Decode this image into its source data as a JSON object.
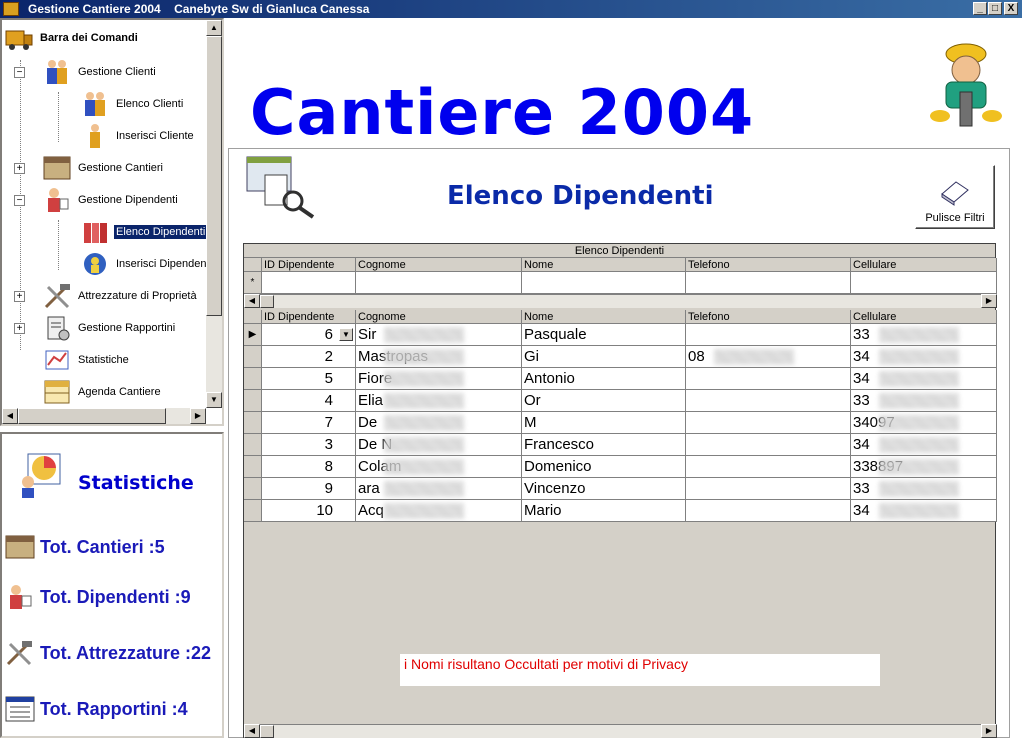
{
  "window": {
    "title": "Gestione Cantiere 2004    Canebyte Sw di Gianluca Canessa",
    "min_label": "_",
    "max_label": "□",
    "close_label": "X"
  },
  "tree": {
    "root": "Barra dei Comandi",
    "items": [
      {
        "label": "Gestione Clienti"
      },
      {
        "label": "Elenco Clienti"
      },
      {
        "label": "Inserisci Cliente"
      },
      {
        "label": "Gestione Cantieri"
      },
      {
        "label": "Gestione Dipendenti"
      },
      {
        "label": "Elenco Dipendenti"
      },
      {
        "label": "Inserisci Dipendent"
      },
      {
        "label": "Attrezzature di Proprietà"
      },
      {
        "label": "Gestione Rapportini"
      },
      {
        "label": "Statistiche"
      },
      {
        "label": "Agenda Cantiere"
      }
    ],
    "expand_plus": "+",
    "expand_minus": "−"
  },
  "stats": {
    "title": "Statistiche",
    "cantieri": "Tot. Cantieri :5",
    "dipendenti": "Tot. Dipendenti :9",
    "attrezzature": "Tot. Attrezzature :22",
    "rapportini": "Tot. Rapportini :4"
  },
  "main": {
    "big_title": "Cantiere 2004",
    "form_title": "Elenco Dipendenti",
    "clear_button": "Pulisce Filtri",
    "privacy_note": "i Nomi risultano Occultati per motivi di Privacy"
  },
  "grid": {
    "caption": "Elenco Dipendenti",
    "columns": [
      "ID Dipendente",
      "Cognome",
      "Nome",
      "Telefono",
      "Cellulare"
    ],
    "new_row_marker": "*",
    "current_row_marker": "▶",
    "rows": [
      {
        "id": "6",
        "cognome": "Sir",
        "nome": "Pasquale",
        "telefono": "",
        "cellulare": "33"
      },
      {
        "id": "2",
        "cognome": "Mastropas",
        "nome": "Gi",
        "telefono": "08",
        "cellulare": "34"
      },
      {
        "id": "5",
        "cognome": "Fiore",
        "nome": "Antonio",
        "telefono": "",
        "cellulare": "34"
      },
      {
        "id": "4",
        "cognome": "Elia",
        "nome": "Or",
        "telefono": "",
        "cellulare": "33"
      },
      {
        "id": "7",
        "cognome": "De",
        "nome": "M",
        "telefono": "",
        "cellulare": "34097"
      },
      {
        "id": "3",
        "cognome": "De N",
        "nome": "Francesco",
        "telefono": "",
        "cellulare": "34"
      },
      {
        "id": "8",
        "cognome": "Colam",
        "nome": "Domenico",
        "telefono": "",
        "cellulare": "338897"
      },
      {
        "id": "9",
        "cognome": "ara",
        "nome": "Vincenzo",
        "telefono": "",
        "cellulare": "33"
      },
      {
        "id": "10",
        "cognome": "Acq",
        "nome": "Mario",
        "telefono": "",
        "cellulare": "34"
      }
    ]
  },
  "colors": {
    "title_blue": "#0000ee",
    "stats_blue": "#1a1ab8",
    "selection": "#0a246a",
    "privacy_red": "#e00000"
  },
  "icons": [
    "app-icon",
    "truck-icon",
    "people-icon",
    "person-icon",
    "calendar-icon",
    "worker-icon",
    "tools-icon",
    "report-icon",
    "chart-icon",
    "list-icon",
    "eraser-icon"
  ]
}
